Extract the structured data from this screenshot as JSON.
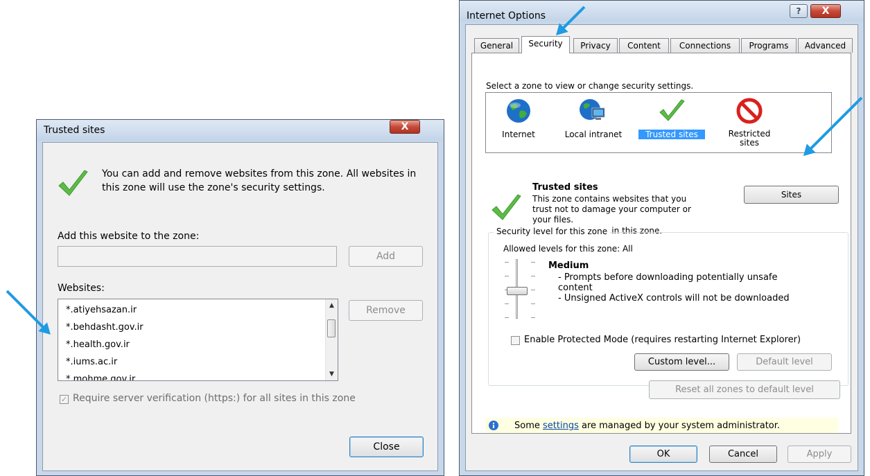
{
  "trusted_sites": {
    "title": "Trusted sites",
    "close_glyph": "X",
    "description_line1": "You can add and remove websites from this zone. All websites in",
    "description_line2": "this zone will use the zone's security settings.",
    "add_label": "Add this website to the zone:",
    "add_input_value": "",
    "add_button": "Add",
    "websites_label": "Websites:",
    "websites": [
      "*.atiyehsazan.ir",
      "*.behdasht.gov.ir",
      "*.health.gov.ir",
      "*.iums.ac.ir",
      "*.mohme.gov.ir"
    ],
    "remove_button": "Remove",
    "require_https_label": "Require server verification (https:) for all sites in this zone",
    "require_https_checked": true,
    "close_button": "Close"
  },
  "internet_options": {
    "title": "Internet Options",
    "help_glyph": "?",
    "close_glyph": "X",
    "tabs": [
      "General",
      "Security",
      "Privacy",
      "Content",
      "Connections",
      "Programs",
      "Advanced"
    ],
    "selected_tab": "Security",
    "zone_prompt": "Select a zone to view or change security settings.",
    "zones": [
      {
        "label": "Internet",
        "icon": "globe-icon"
      },
      {
        "label": "Local intranet",
        "icon": "intranet-icon"
      },
      {
        "label": "Trusted sites",
        "icon": "checkmark-icon"
      },
      {
        "label_line1": "Restricted",
        "label_line2": "sites",
        "icon": "restricted-icon"
      }
    ],
    "selected_zone": "Trusted sites",
    "zone_title": "Trusted sites",
    "zone_desc_line1": "This zone contains websites that you",
    "zone_desc_line2": "trust not to damage your computer or",
    "zone_desc_line3": "your files.",
    "zone_desc_line4": "You have websites in this zone.",
    "sites_button": "Sites",
    "security_level_group": "Security level for this zone",
    "allowed_levels": "Allowed levels for this zone: All",
    "level_name": "Medium",
    "level_desc_line1": "- Prompts before downloading potentially unsafe",
    "level_desc_line2": "content",
    "level_desc_line3": "- Unsigned ActiveX controls will not be downloaded",
    "protected_mode_label": "Enable Protected Mode (requires restarting Internet Explorer)",
    "protected_mode_checked": false,
    "custom_level_button": "Custom level...",
    "default_level_button": "Default level",
    "reset_all_button": "Reset all zones to default level",
    "info_prefix": "Some ",
    "info_link": "settings",
    "info_suffix": " are managed by your system administrator.",
    "ok_button": "OK",
    "cancel_button": "Cancel",
    "apply_button": "Apply"
  },
  "colors": {
    "accent_arrow": "#1f9be3",
    "selection": "#3399ff",
    "info_bar": "#ffffe1"
  }
}
